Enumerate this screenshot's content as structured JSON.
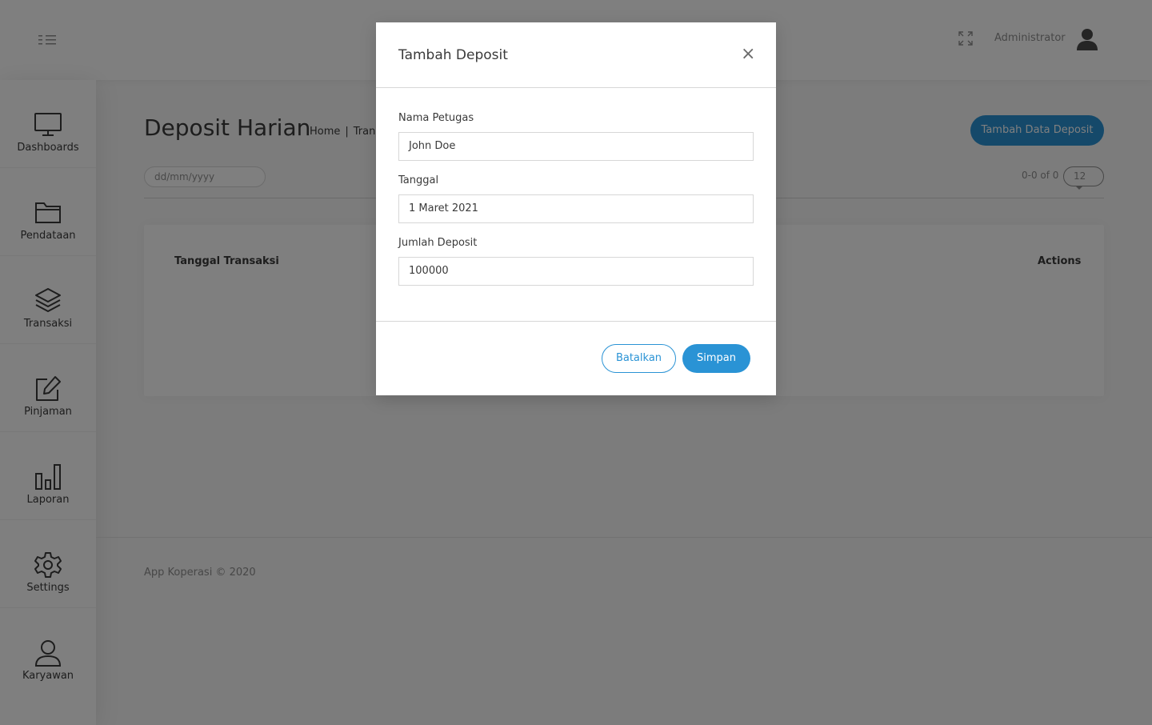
{
  "header": {
    "user_name": "Administrator"
  },
  "sidebar": {
    "items": [
      {
        "label": "Dashboards",
        "icon": "monitor-icon"
      },
      {
        "label": "Pendataan",
        "icon": "folder-icon"
      },
      {
        "label": "Transaksi",
        "icon": "layers-icon"
      },
      {
        "label": "Pinjaman",
        "icon": "edit-icon"
      },
      {
        "label": "Laporan",
        "icon": "bar-chart-icon"
      },
      {
        "label": "Settings",
        "icon": "gear-icon"
      },
      {
        "label": "Karyawan",
        "icon": "user-icon"
      }
    ]
  },
  "main": {
    "title": "Deposit Harian",
    "breadcrumb": [
      "Home",
      "Trans"
    ],
    "add_button": "Tambah Data Deposit",
    "date_filter_placeholder": "dd/mm/yyyy",
    "page_count": "0-0 of 0",
    "per_page": "12",
    "table_headers": [
      "Tanggal Transaksi",
      "Actions"
    ]
  },
  "footer": {
    "text": "App Koperasi © 2020"
  },
  "modal": {
    "title": "Tambah Deposit",
    "close_symbol": "×",
    "fields": [
      {
        "label": "Nama Petugas",
        "value": "John Doe"
      },
      {
        "label": "Tanggal",
        "value": "1 Maret 2021"
      },
      {
        "label": "Jumlah Deposit",
        "value": "100000"
      }
    ],
    "cancel_label": "Batalkan",
    "save_label": "Simpan"
  },
  "colors": {
    "primary": "#2a93d5",
    "overlay": "rgba(0,0,0,0.5)"
  }
}
